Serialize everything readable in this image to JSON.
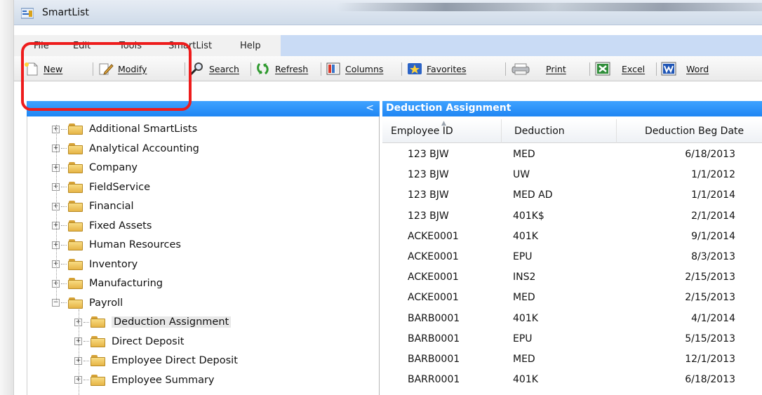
{
  "window": {
    "title": "SmartList"
  },
  "menu": [
    "File",
    "Edit",
    "Tools",
    "SmartList",
    "Help"
  ],
  "toolbar": {
    "new": "New",
    "modify": "Modify",
    "search": "Search",
    "refresh": "Refresh",
    "columns": "Columns",
    "favorites": "Favorites",
    "print": "Print",
    "excel": "Excel",
    "word": "Word"
  },
  "tree": {
    "collapse_glyph": "<",
    "items": [
      {
        "label": "Additional SmartLists",
        "level": 0,
        "expander": "+"
      },
      {
        "label": "Analytical Accounting",
        "level": 0,
        "expander": "+"
      },
      {
        "label": "Company",
        "level": 0,
        "expander": "+"
      },
      {
        "label": "FieldService",
        "level": 0,
        "expander": "+"
      },
      {
        "label": "Financial",
        "level": 0,
        "expander": "+"
      },
      {
        "label": "Fixed Assets",
        "level": 0,
        "expander": "+"
      },
      {
        "label": "Human Resources",
        "level": 0,
        "expander": "+"
      },
      {
        "label": "Inventory",
        "level": 0,
        "expander": "+"
      },
      {
        "label": "Manufacturing",
        "level": 0,
        "expander": "+"
      },
      {
        "label": "Payroll",
        "level": 0,
        "expander": "−"
      },
      {
        "label": "Deduction Assignment",
        "level": 1,
        "expander": "+",
        "selected": true
      },
      {
        "label": "Direct Deposit",
        "level": 1,
        "expander": "+"
      },
      {
        "label": "Employee Direct Deposit",
        "level": 1,
        "expander": "+"
      },
      {
        "label": "Employee Summary",
        "level": 1,
        "expander": "+"
      }
    ]
  },
  "results": {
    "title": "Deduction Assignment",
    "columns": [
      "Employee ID",
      "Deduction",
      "Deduction Beg Date"
    ],
    "rows": [
      [
        "123 BJW",
        "MED",
        "6/18/2013"
      ],
      [
        "123 BJW",
        "UW",
        "1/1/2012"
      ],
      [
        "123 BJW",
        "MED AD",
        "1/1/2014"
      ],
      [
        "123 BJW",
        "401K$",
        "2/1/2014"
      ],
      [
        "ACKE0001",
        "401K",
        "9/1/2014"
      ],
      [
        "ACKE0001",
        "EPU",
        "8/3/2013"
      ],
      [
        "ACKE0001",
        "INS2",
        "2/15/2013"
      ],
      [
        "ACKE0001",
        "MED",
        "2/15/2013"
      ],
      [
        "BARB0001",
        "401K",
        "4/1/2014"
      ],
      [
        "BARB0001",
        "EPU",
        "5/15/2013"
      ],
      [
        "BARB0001",
        "MED",
        "12/1/2013"
      ],
      [
        "BARR0001",
        "401K",
        "6/18/2013"
      ]
    ]
  },
  "colors": {
    "header_blue": "#2a90f7",
    "highlight_red": "#ee1c1c",
    "folder_yellow": "#f2c95d"
  }
}
